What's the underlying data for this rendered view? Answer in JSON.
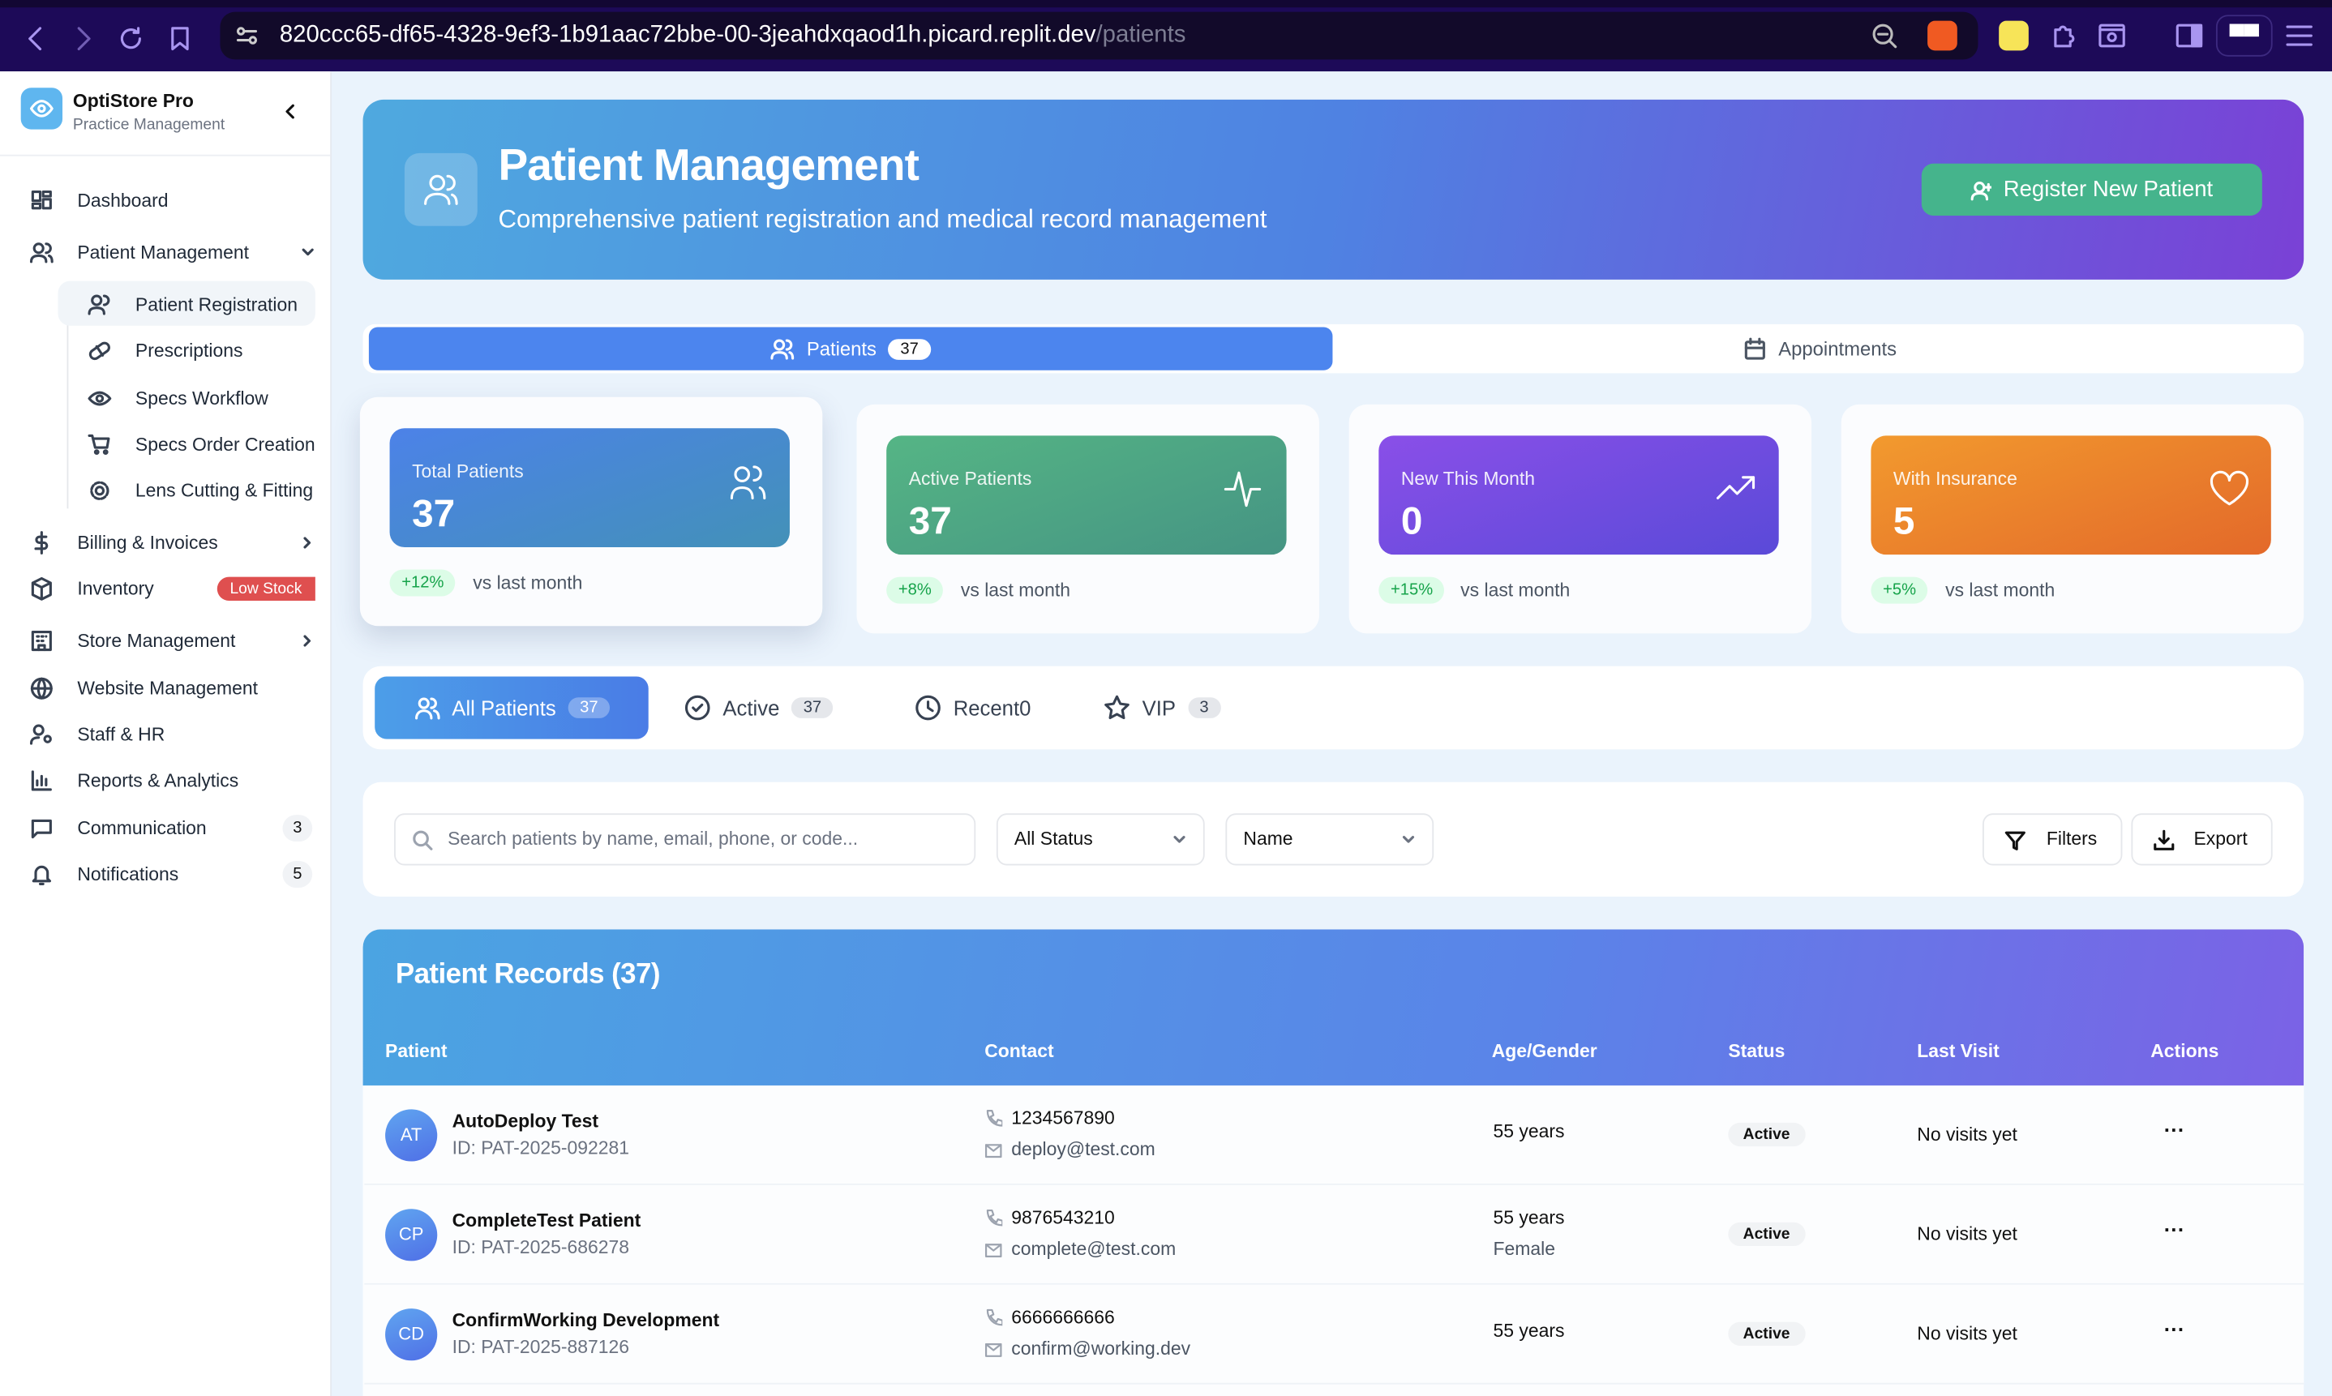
{
  "browser": {
    "url_host": "820ccc65-df65-4328-9ef3-1b91aac72bbe-00-3jeahdxqaod1h.picard.replit.dev",
    "url_path": "/patients"
  },
  "sidebar": {
    "app_name": "OptiStore Pro",
    "app_subtitle": "Practice Management",
    "items": [
      {
        "label": "Dashboard"
      },
      {
        "label": "Patient Management"
      },
      {
        "label": "Billing & Invoices"
      },
      {
        "label": "Inventory",
        "badge": "Low Stock"
      },
      {
        "label": "Store Management"
      },
      {
        "label": "Website Management"
      },
      {
        "label": "Staff & HR"
      },
      {
        "label": "Reports & Analytics"
      },
      {
        "label": "Communication",
        "count": "3"
      },
      {
        "label": "Notifications",
        "count": "5"
      }
    ],
    "sub_items": [
      {
        "label": "Patient Registration"
      },
      {
        "label": "Prescriptions"
      },
      {
        "label": "Specs Workflow"
      },
      {
        "label": "Specs Order Creation"
      },
      {
        "label": "Lens Cutting & Fitting"
      }
    ]
  },
  "hero": {
    "title": "Patient Management",
    "subtitle": "Comprehensive patient registration and medical record management",
    "button": "Register New Patient"
  },
  "tabs": {
    "patients": "Patients",
    "patients_count": "37",
    "appointments": "Appointments"
  },
  "stats": [
    {
      "label": "Total Patients",
      "value": "37",
      "change": "+12%",
      "vs": "vs last month"
    },
    {
      "label": "Active Patients",
      "value": "37",
      "change": "+8%",
      "vs": "vs last month"
    },
    {
      "label": "New This Month",
      "value": "0",
      "change": "+15%",
      "vs": "vs last month"
    },
    {
      "label": "With Insurance",
      "value": "5",
      "change": "+5%",
      "vs": "vs last month"
    }
  ],
  "filter_tabs": [
    {
      "label": "All Patients",
      "count": "37"
    },
    {
      "label": "Active",
      "count": "37"
    },
    {
      "label": "Recent0"
    },
    {
      "label": "VIP",
      "count": "3"
    }
  ],
  "search": {
    "placeholder": "Search patients by name, email, phone, or code...",
    "status": "All Status",
    "sort": "Name",
    "filters": "Filters",
    "export": "Export"
  },
  "table": {
    "title": "Patient Records (37)",
    "columns": [
      "Patient",
      "Contact",
      "Age/Gender",
      "Status",
      "Last Visit",
      "Actions"
    ],
    "rows": [
      {
        "initials": "AT",
        "name": "AutoDeploy Test",
        "id": "ID: PAT-2025-092281",
        "phone": "1234567890",
        "email": "deploy@test.com",
        "age": "55 years",
        "gender": "",
        "status": "Active",
        "last_visit": "No visits yet",
        "actions": "···"
      },
      {
        "initials": "CP",
        "name": "CompleteTest Patient",
        "id": "ID: PAT-2025-686278",
        "phone": "9876543210",
        "email": "complete@test.com",
        "age": "55 years",
        "gender": "Female",
        "status": "Active",
        "last_visit": "No visits yet",
        "actions": "···"
      },
      {
        "initials": "CD",
        "name": "ConfirmWorking Development",
        "id": "ID: PAT-2025-887126",
        "phone": "6666666666",
        "email": "confirm@working.dev",
        "age": "55 years",
        "gender": "",
        "status": "Active",
        "last_visit": "No visits yet",
        "actions": "···"
      }
    ]
  }
}
